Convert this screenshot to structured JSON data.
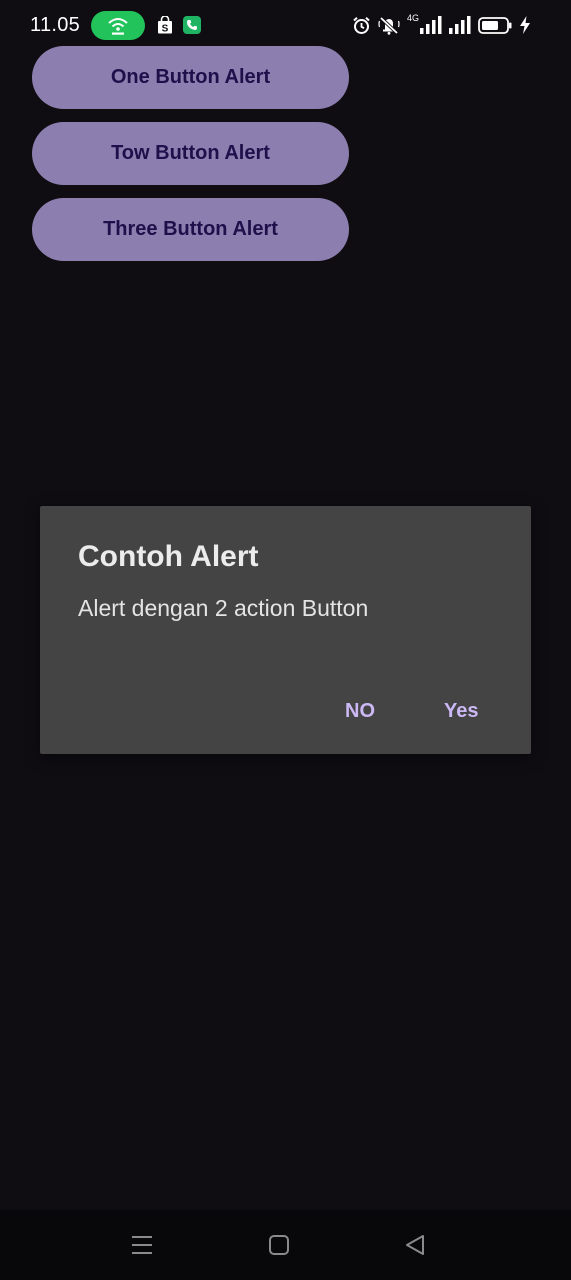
{
  "status_bar": {
    "time": "11.05",
    "network_label": "4G",
    "icons": [
      "hotspot-icon",
      "shopping-bag-icon",
      "call-icon",
      "alarm-icon",
      "mute-icon",
      "signal-icon",
      "signal-icon",
      "battery-icon",
      "charging-icon"
    ]
  },
  "buttons": {
    "one": "One Button Alert",
    "two": "Tow Button Alert",
    "three": "Three Button Alert",
    "color": "#8c7fb0",
    "text_color": "#1f0f4a"
  },
  "dialog": {
    "title": "Contoh Alert",
    "message": "Alert dengan 2 action Button",
    "negative": "NO",
    "positive": "Yes",
    "accent": "#cbb8f5"
  },
  "nav_bar": {
    "icons": [
      "menu-icon",
      "home-icon",
      "back-icon"
    ]
  }
}
